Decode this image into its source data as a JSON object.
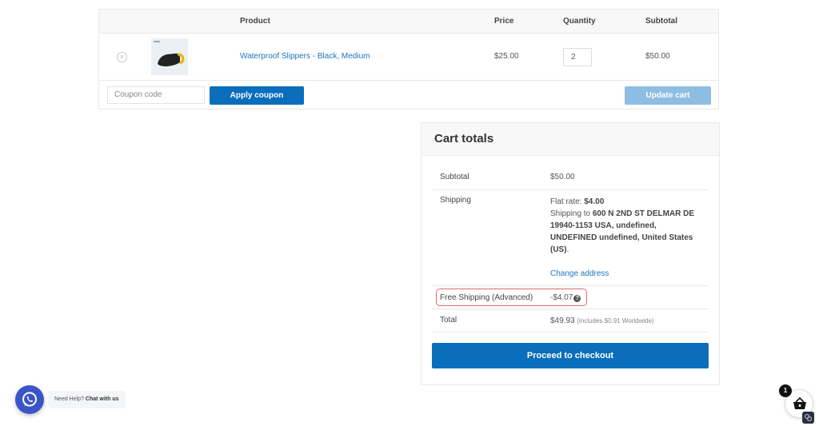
{
  "cart_table": {
    "headers": {
      "product": "Product",
      "price": "Price",
      "quantity": "Quantity",
      "subtotal": "Subtotal"
    },
    "items": [
      {
        "remove_icon": "×",
        "name": "Waterproof Slippers - Black, Medium",
        "price": "$25.00",
        "quantity": "2",
        "subtotal": "$50.00"
      }
    ],
    "coupon_placeholder": "Coupon code",
    "apply_coupon_label": "Apply coupon",
    "update_cart_label": "Update cart"
  },
  "cart_totals": {
    "title": "Cart totals",
    "subtotal_label": "Subtotal",
    "subtotal_value": "$50.00",
    "shipping_label": "Shipping",
    "shipping_method_prefix": "Flat rate: ",
    "shipping_method_amount": "$4.00",
    "shipping_to_prefix": "Shipping to ",
    "shipping_address": "600 N 2ND ST DELMAR DE 19940-1153 USA, undefined, UNDEFINED undefined, United States (US)",
    "shipping_to_suffix": ".",
    "change_address_label": "Change address",
    "discount_label": "Free Shipping (Advanced)",
    "discount_value": "-$4.07",
    "discount_help_icon": "?",
    "total_label": "Total",
    "total_value": "$49.93",
    "total_note": "(includes $0.91 Worldwide)",
    "checkout_label": "Proceed to checkout"
  },
  "chat_widget": {
    "prefix": "Need Help? ",
    "label": "Chat with us"
  },
  "mini_cart": {
    "count": "1"
  },
  "colors": {
    "primary": "#0a6ebd",
    "primary_disabled": "#8dbde3",
    "link": "#1e73be",
    "highlight": "#e06a6a",
    "whatsapp": "#3b55c8"
  }
}
